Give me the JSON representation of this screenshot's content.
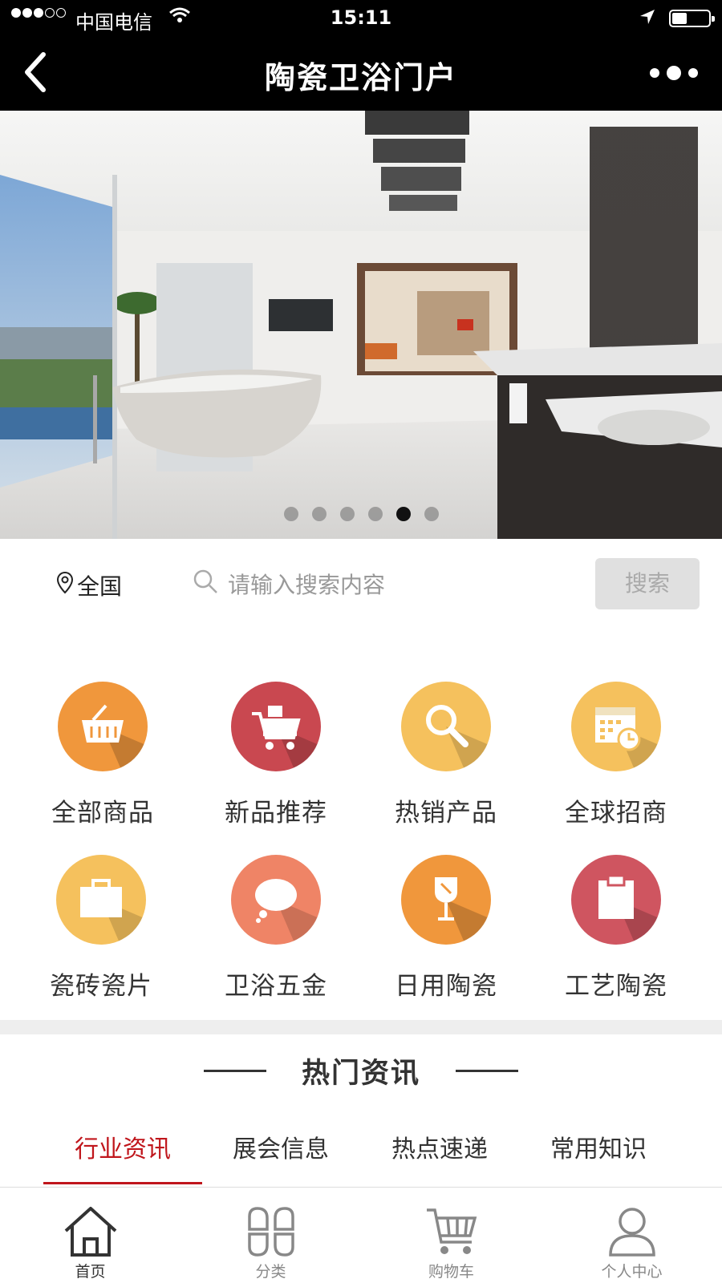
{
  "status_bar": {
    "carrier": "中国电信",
    "time": "15:11"
  },
  "nav": {
    "title": "陶瓷卫浴门户"
  },
  "banner": {
    "slide_count": 6,
    "active_index": 4
  },
  "search": {
    "region": "全国",
    "placeholder": "请输入搜索内容",
    "button": "搜索"
  },
  "categories": [
    {
      "label": "全部商品",
      "icon": "basket-icon",
      "color": "#f0973c"
    },
    {
      "label": "新品推荐",
      "icon": "cart-icon",
      "color": "#c94850"
    },
    {
      "label": "热销产品",
      "icon": "magnifier-icon",
      "color": "#f5c15d"
    },
    {
      "label": "全球招商",
      "icon": "calendar-icon",
      "color": "#f5c15d"
    },
    {
      "label": "瓷砖瓷片",
      "icon": "briefcase-icon",
      "color": "#f5c15d"
    },
    {
      "label": "卫浴五金",
      "icon": "speech-bubble-icon",
      "color": "#ef8466"
    },
    {
      "label": "日用陶瓷",
      "icon": "wine-glass-icon",
      "color": "#f0973c"
    },
    {
      "label": "工艺陶瓷",
      "icon": "clipboard-icon",
      "color": "#cf5560"
    }
  ],
  "hot_news": {
    "title": "热门资讯",
    "tabs": [
      "行业资讯",
      "展会信息",
      "热点速递",
      "常用知识"
    ],
    "active_tab": 0
  },
  "bottom_nav": [
    {
      "label": "首页",
      "icon": "home-icon"
    },
    {
      "label": "分类",
      "icon": "category-grid-icon"
    },
    {
      "label": "购物车",
      "icon": "shopping-cart-icon"
    },
    {
      "label": "个人中心",
      "icon": "user-icon"
    }
  ],
  "colors": {
    "accent_red": "#c0161c",
    "nav_bg": "#000000"
  }
}
